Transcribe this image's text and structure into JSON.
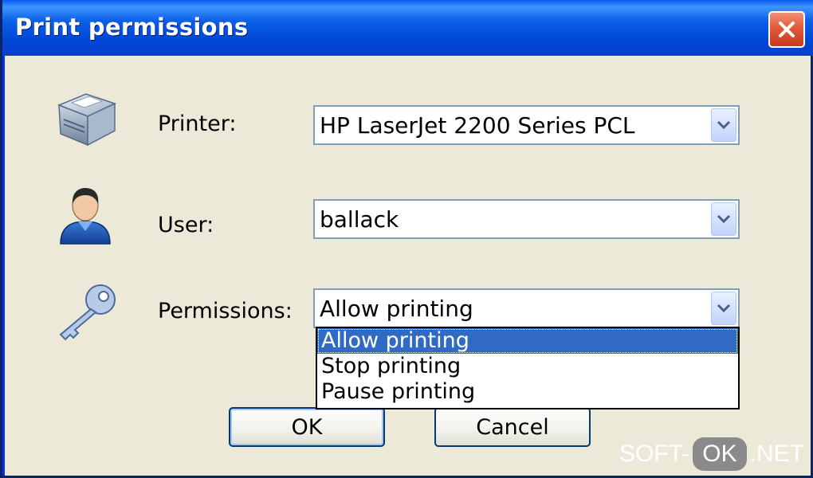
{
  "window": {
    "title": "Print permissions",
    "close_icon": "close-icon"
  },
  "form": {
    "printer": {
      "label": "Printer:",
      "value": "HP LaserJet 2200 Series PCL",
      "icon": "printer-icon"
    },
    "user": {
      "label": "User:",
      "value": "ballack",
      "icon": "user-icon"
    },
    "permissions": {
      "label": "Permissions:",
      "value": "Allow printing",
      "icon": "key-icon",
      "options": [
        "Allow printing",
        "Stop printing",
        "Pause printing"
      ],
      "selected_index": 0
    }
  },
  "buttons": {
    "ok": "OK",
    "cancel": "Cancel"
  },
  "watermark": {
    "part1": "SOFT-",
    "part2": "OK",
    "part3": ".NET"
  },
  "colors": {
    "titlebar": "#0a5fe6",
    "dialog_bg": "#ece9d8",
    "selection": "#316ac5",
    "close_button": "#e25a3a"
  }
}
